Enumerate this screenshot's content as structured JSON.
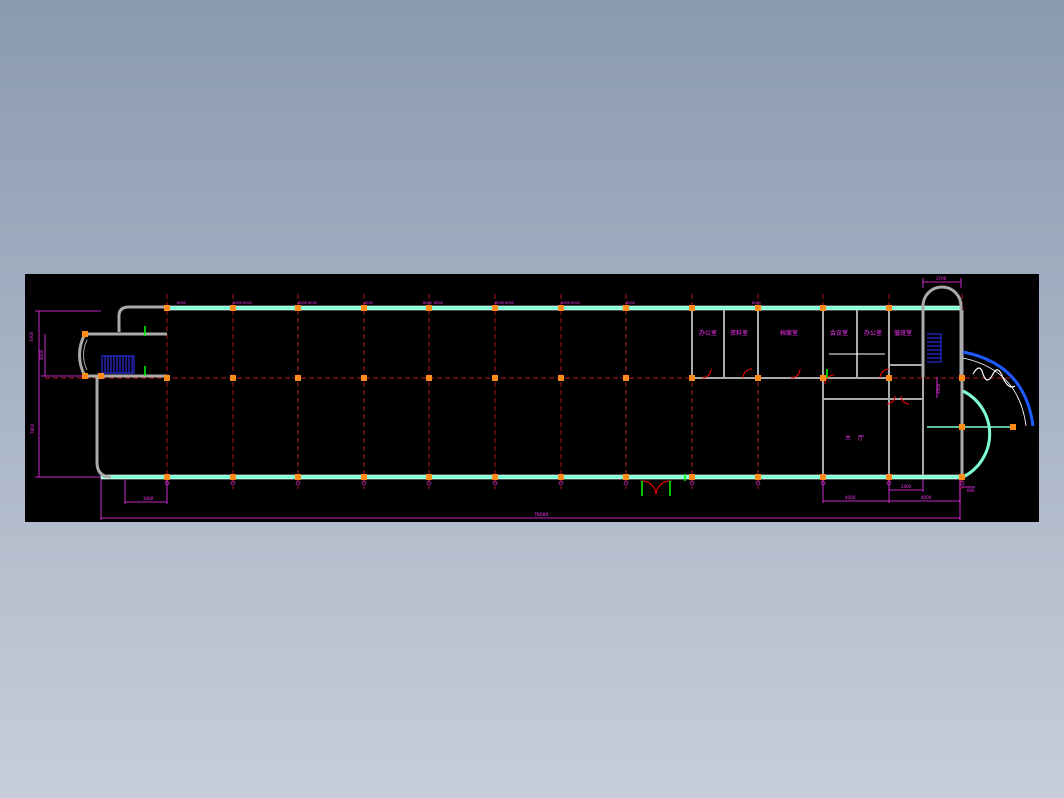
{
  "drawing": {
    "room_labels": [
      "办公室",
      "资料室",
      "档案室",
      "会议室",
      "办公室",
      "值班室"
    ],
    "top_dims": [
      "6000",
      "6000",
      "6000",
      "6000",
      "6000",
      "6000",
      "6000",
      "6000",
      "6000",
      "6000",
      "6000",
      "6000",
      "6000",
      "6000"
    ],
    "left_dims": [
      "3000",
      "7800",
      "4000",
      "3500"
    ],
    "bottom_dims": {
      "overall": "78000",
      "left_stub": "3000",
      "right_a": "4000",
      "right_b": "4000",
      "right_c": "2400",
      "right_d": "600",
      "right_top": "3700"
    },
    "hall_text": [
      "大",
      "厅"
    ],
    "colors": {
      "background": "#000000",
      "wall": "#7fffd4",
      "axis": "#ff2020",
      "column": "#ff8c1a",
      "dimension": "#ff33ff",
      "stair": "#3333ff",
      "door": "#ff0000"
    }
  }
}
